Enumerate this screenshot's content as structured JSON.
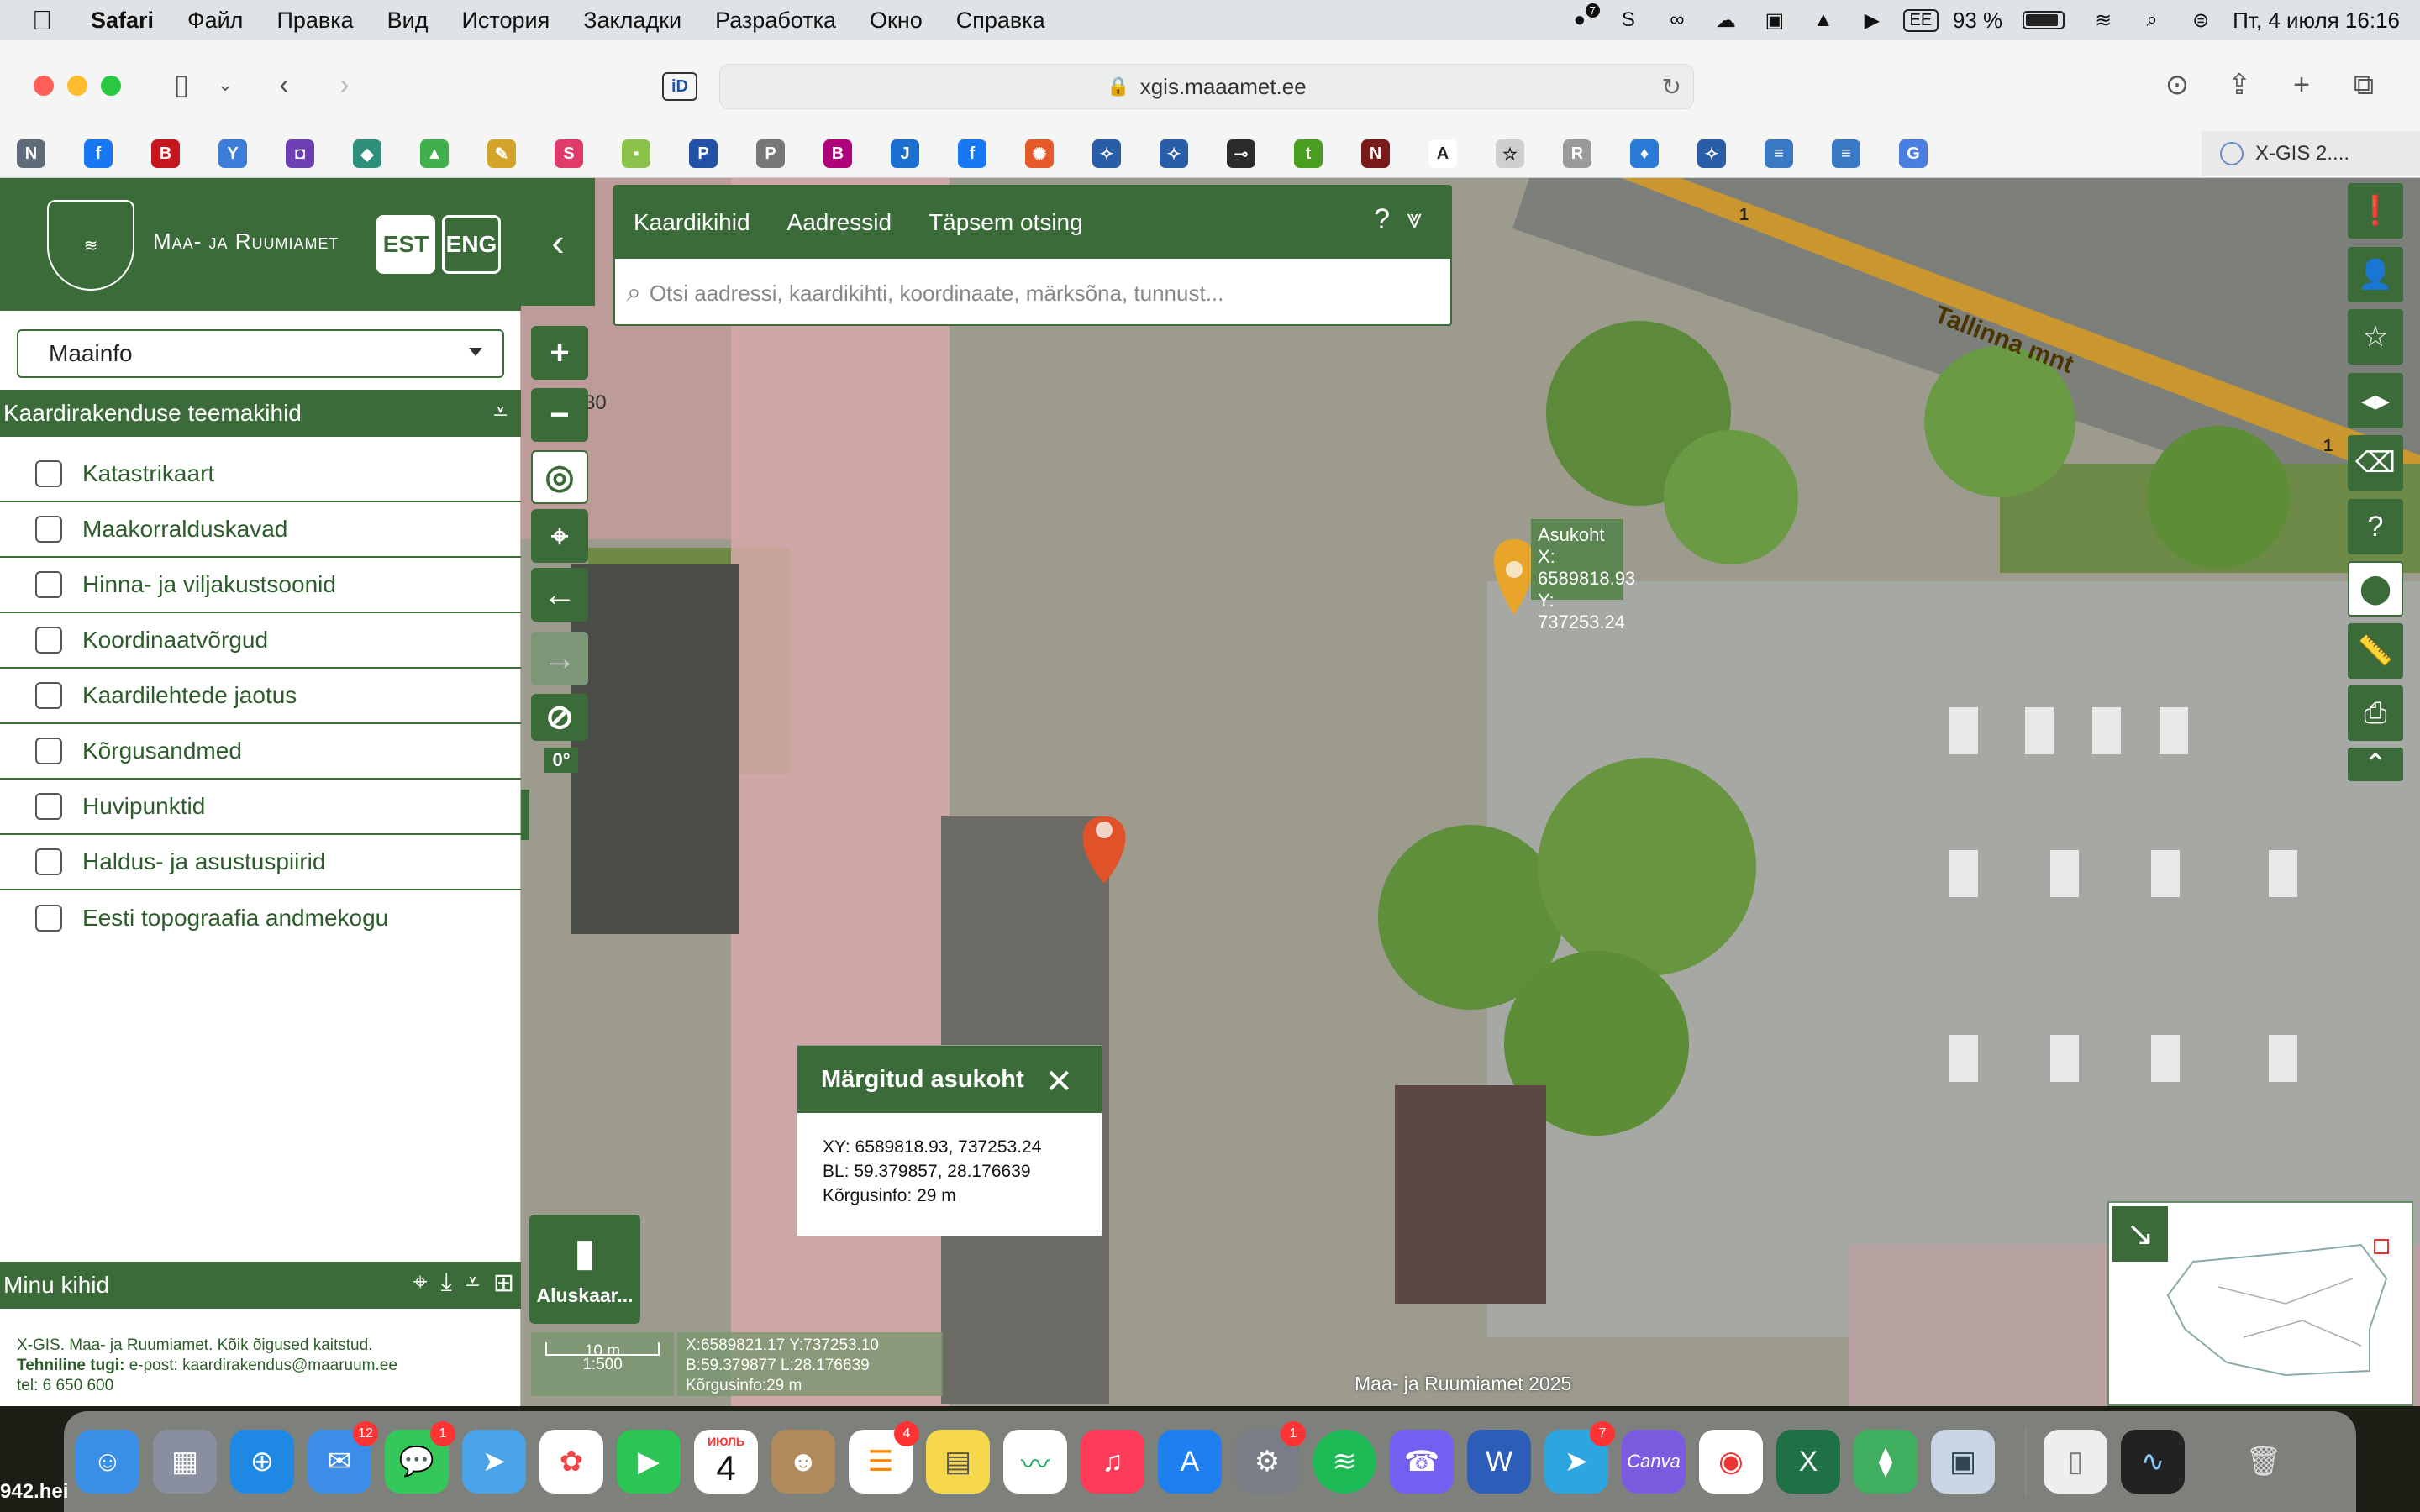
{
  "menubar": {
    "app_name": "Safari",
    "items": [
      "Файл",
      "Правка",
      "Вид",
      "История",
      "Закладки",
      "Разработка",
      "Окно",
      "Справка"
    ],
    "right": {
      "input_source": "EE",
      "battery": "93 %",
      "datetime": "Пт, 4 июля  16:16",
      "badge_count": "7"
    }
  },
  "browser": {
    "url": "xgis.maaamet.ee",
    "active_tab_title": "X-GIS 2....",
    "id_icon": "iD",
    "favicons": [
      {
        "letter": "N",
        "color": "#606b7a"
      },
      {
        "letter": "f",
        "color": "#1877f2"
      },
      {
        "letter": "B",
        "color": "#c4161c"
      },
      {
        "letter": "Y",
        "color": "#3b7dd8"
      },
      {
        "letter": "◘",
        "color": "#6c3fb5"
      },
      {
        "letter": "◆",
        "color": "#2e8f7a"
      },
      {
        "letter": "▲",
        "color": "#3fb04c"
      },
      {
        "letter": "✎",
        "color": "#d4a32a"
      },
      {
        "letter": "S",
        "color": "#e03a6a"
      },
      {
        "letter": "▪",
        "color": "#8bc34a"
      },
      {
        "letter": "P",
        "color": "#2451a8"
      },
      {
        "letter": "P",
        "color": "#777777"
      },
      {
        "letter": "B",
        "color": "#b0007a"
      },
      {
        "letter": "J",
        "color": "#1b6fd0"
      },
      {
        "letter": "f",
        "color": "#1877f2"
      },
      {
        "letter": "✺",
        "color": "#e65a2a"
      },
      {
        "letter": "✧",
        "color": "#2a5da8"
      },
      {
        "letter": "✧",
        "color": "#2a5da8"
      },
      {
        "letter": "⊸",
        "color": "#2b2b2b"
      },
      {
        "letter": "t",
        "color": "#4a9e1f"
      },
      {
        "letter": "N",
        "color": "#7a1a1a"
      },
      {
        "letter": "A",
        "color": "#ffffff"
      },
      {
        "letter": "☆",
        "color": "#cfcfcf"
      },
      {
        "letter": "R",
        "color": "#9a9a9a"
      },
      {
        "letter": "♦",
        "color": "#2a7ad8"
      },
      {
        "letter": "✧",
        "color": "#2a5da8"
      },
      {
        "letter": "≡",
        "color": "#3b79c4"
      },
      {
        "letter": "≡",
        "color": "#3b79c4"
      },
      {
        "letter": "G",
        "color": "#4a7ee0"
      }
    ]
  },
  "sidebar": {
    "org_name": "Maa- ja Ruumiamet",
    "lang_est": "EST",
    "lang_eng": "ENG",
    "dropdown_value": "Maainfo",
    "theme_section_title": "Kaardirakenduse teemakihid",
    "layers": [
      "Katastrikaart",
      "Maakorralduskavad",
      "Hinna- ja viljakustsoonid",
      "Koordinaatvõrgud",
      "Kaardilehtede jaotus",
      "Kõrgusandmed",
      "Huvipunktid",
      "Haldus- ja asustuspiirid",
      "Eesti topograafia andmekogu"
    ],
    "my_layers_title": "Minu kihid",
    "footer": {
      "line1": "X-GIS. Maa- ja Ruumiamet. Kõik õigused kaitstud.",
      "support_label": "Tehniline tugi:",
      "support_value": " e-post: kaardirakendus@maaruum.ee",
      "phone": "tel: 6 650 600"
    }
  },
  "search": {
    "tabs": [
      "Kaardikihid",
      "Aadressid",
      "Täpsem otsing"
    ],
    "placeholder": "Otsi aadressi, kaardikihti, koordinaate, märksõna, tunnust...",
    "help": "?"
  },
  "map": {
    "rotation": "0°",
    "road_label": "Tallinna mnt",
    "road_number": "1",
    "pin_label": {
      "title": "Asukoht",
      "x": "X: 6589818.93",
      "y": "Y: 737253.24"
    },
    "popup": {
      "title": "Märgitud asukoht",
      "xy": "XY: 6589818.93, 737253.24",
      "bl": "BL: 59.379857, 28.176639",
      "height": "Kõrgusinfo: 29 m"
    },
    "basemap_label": "Aluskaar...",
    "scale_text": "10 m",
    "scale_ratio": "1:500",
    "coords_line1": "X:6589821.17 Y:737253.10",
    "coords_line2": "B:59.379877 L:28.176639",
    "coords_line3": "Kõrgusinfo:29 m",
    "attribution": "Maa- ja Ruumiamet 2025",
    "building_number": "30"
  },
  "dock": {
    "calendar_month": "ИЮЛЬ",
    "calendar_day": "4",
    "badges": {
      "mail": "12",
      "messages": "1",
      "reminders": "4",
      "settings": "1",
      "telegram": "7"
    },
    "canva_label": "Canva",
    "word_letter": "W",
    "excel_letter": "X"
  },
  "desktop_label": "942.hei"
}
